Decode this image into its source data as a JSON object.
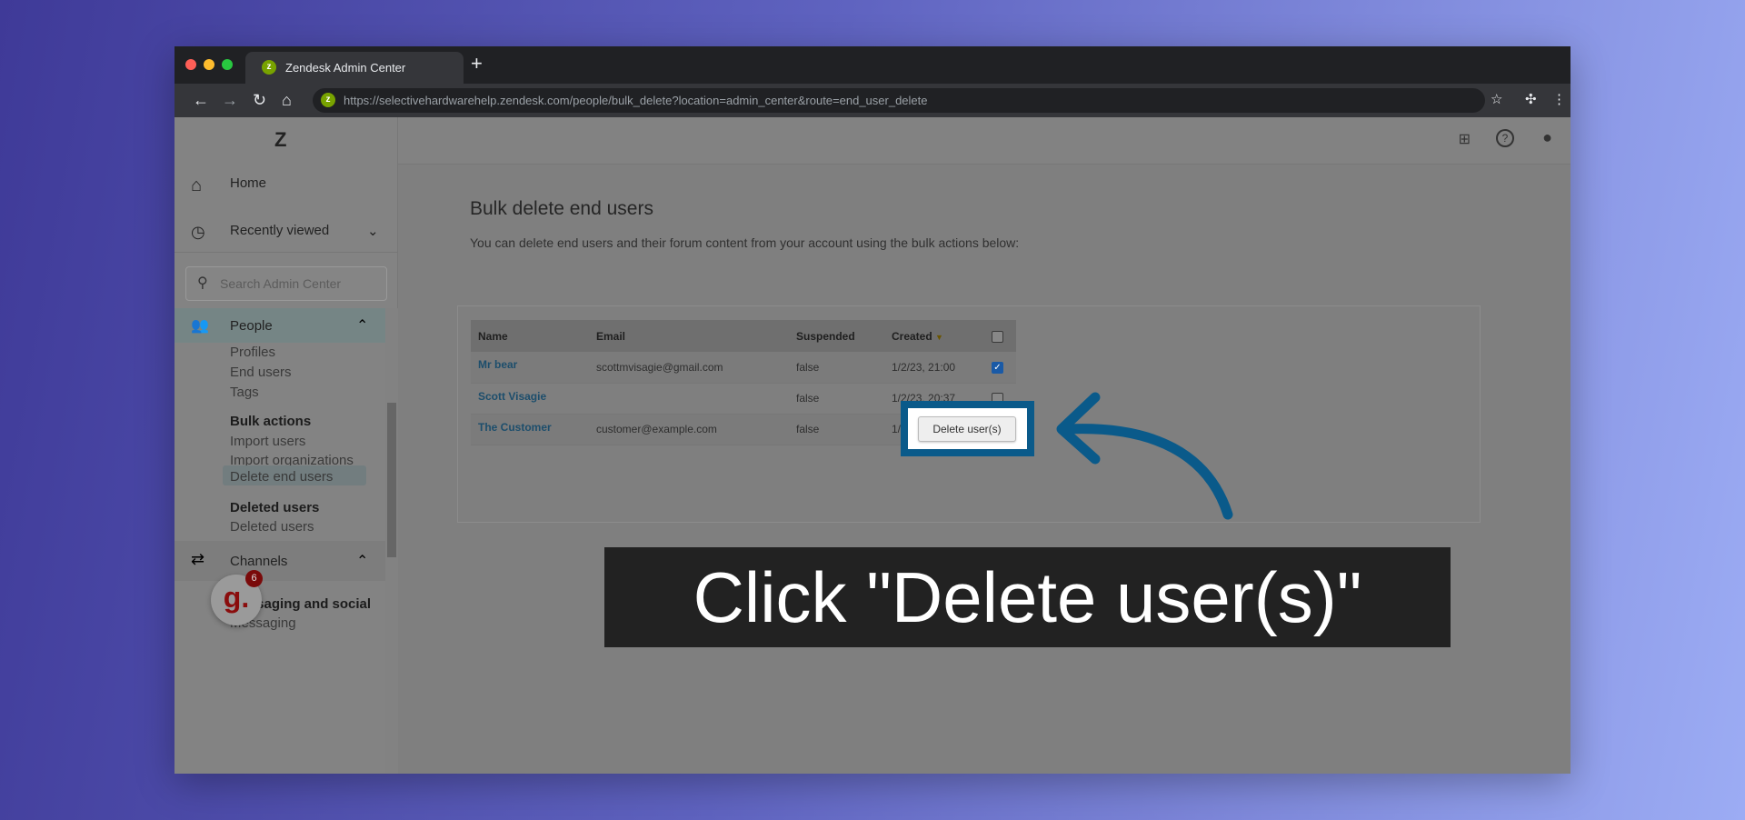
{
  "browser": {
    "tab_title": "Zendesk Admin Center",
    "url": "https://selectivehardwarehelp.zendesk.com/people/bulk_delete?location=admin_center&route=end_user_delete"
  },
  "sidebar": {
    "home": "Home",
    "recent": "Recently viewed",
    "search_placeholder": "Search Admin Center",
    "people": "People",
    "people_items": [
      "Profiles",
      "End users",
      "Tags"
    ],
    "bulk_header": "Bulk actions",
    "bulk_items": [
      "Import users",
      "Import organizations",
      "Delete end users"
    ],
    "deleted_header": "Deleted users",
    "deleted_items": [
      "Deleted users"
    ],
    "channels": "Channels",
    "channels_header": "Messaging and social",
    "channels_items": [
      "Messaging"
    ],
    "badge_count": "6",
    "badge_letter": "g."
  },
  "main": {
    "title": "Bulk delete end users",
    "description": "You can delete end users and their forum content from your account using the bulk actions below:",
    "columns": [
      "Name",
      "Email",
      "Suspended",
      "Created"
    ],
    "rows": [
      {
        "name": "Mr bear",
        "email": "scottmvisagie@gmail.com",
        "suspended": "false",
        "created": "1/2/23, 21:00",
        "checked": true
      },
      {
        "name": "Scott Visagie",
        "email": "",
        "suspended": "false",
        "created": "1/2/23, 20:37",
        "checked": false
      },
      {
        "name": "The Customer",
        "email": "customer@example.com",
        "suspended": "false",
        "created": "1/2/23, 16:08",
        "checked": true
      }
    ],
    "delete_button": "Delete user(s)"
  },
  "caption": "Click \"Delete user(s)\"",
  "colors": {
    "highlight": "#0a5a8a",
    "zendesk_green": "#78a300"
  }
}
